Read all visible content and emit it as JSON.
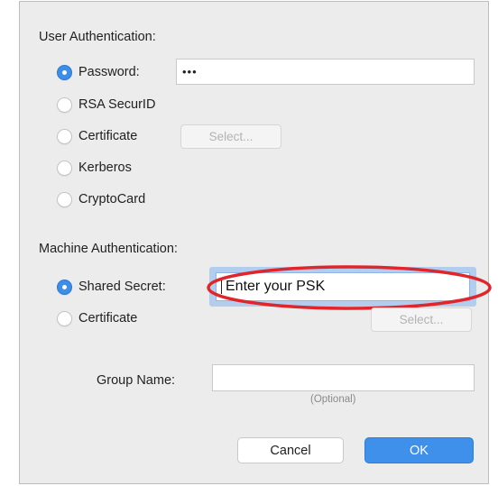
{
  "user_auth": {
    "heading": "User Authentication:",
    "options": [
      {
        "label": "Password:",
        "checked": true
      },
      {
        "label": "RSA SecurID",
        "checked": false
      },
      {
        "label": "Certificate",
        "checked": false
      },
      {
        "label": "Kerberos",
        "checked": false
      },
      {
        "label": "CryptoCard",
        "checked": false
      }
    ],
    "password_value": "•••",
    "select_label": "Select..."
  },
  "machine_auth": {
    "heading": "Machine Authentication:",
    "options": [
      {
        "label": "Shared Secret:",
        "checked": true
      },
      {
        "label": "Certificate",
        "checked": false
      }
    ],
    "shared_secret_value": "Enter your PSK",
    "select_label": "Select..."
  },
  "group": {
    "label": "Group Name:",
    "value": "",
    "hint": "(Optional)"
  },
  "buttons": {
    "cancel": "Cancel",
    "ok": "OK"
  },
  "colors": {
    "accent": "#3f90ea",
    "annotation": "#e0252b"
  }
}
